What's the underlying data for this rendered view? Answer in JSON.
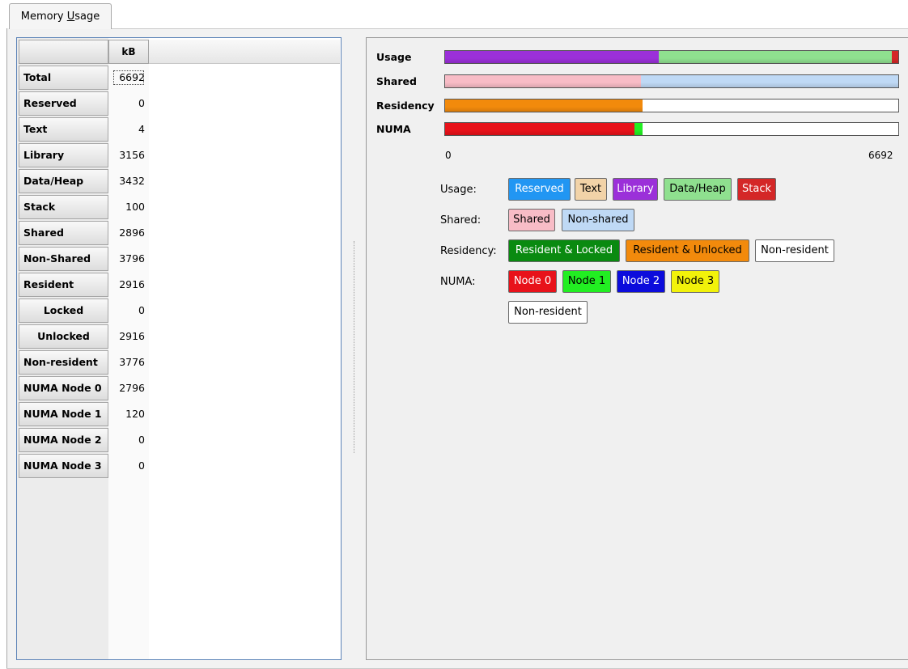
{
  "tab": {
    "label_pre": "Memory ",
    "label_mnemonic": "U",
    "label_post": "sage"
  },
  "table": {
    "column_header": "kB",
    "rows": [
      {
        "label": "Total",
        "value": "6692"
      },
      {
        "label": "Reserved",
        "value": "0"
      },
      {
        "label": "Text",
        "value": "4"
      },
      {
        "label": "Library",
        "value": "3156"
      },
      {
        "label": "Data/Heap",
        "value": "3432"
      },
      {
        "label": "Stack",
        "value": "100"
      },
      {
        "label": "Shared",
        "value": "2896"
      },
      {
        "label": "Non-Shared",
        "value": "3796"
      },
      {
        "label": "Resident",
        "value": "2916"
      },
      {
        "label": "Locked",
        "value": "0"
      },
      {
        "label": "Unlocked",
        "value": "2916"
      },
      {
        "label": "Non-resident",
        "value": "3776"
      },
      {
        "label": "NUMA Node 0",
        "value": "2796"
      },
      {
        "label": "NUMA Node 1",
        "value": "120"
      },
      {
        "label": "NUMA Node 2",
        "value": "0"
      },
      {
        "label": "NUMA Node 3",
        "value": "0"
      }
    ]
  },
  "bars": {
    "labels": {
      "usage": "Usage",
      "shared": "Shared",
      "residency": "Residency",
      "numa": "NUMA"
    },
    "axis_min": "0",
    "axis_max": "6692",
    "total": 6692,
    "usage": [
      {
        "name": "Reserved",
        "value": 0,
        "color": "#2196f3"
      },
      {
        "name": "Text",
        "value": 4,
        "color": "#f2d3a8"
      },
      {
        "name": "Library",
        "value": 3156,
        "color": "#9b30d9"
      },
      {
        "name": "Data/Heap",
        "value": 3432,
        "color": "#8fe08f"
      },
      {
        "name": "Stack",
        "value": 100,
        "color": "#d42727"
      }
    ],
    "shared": [
      {
        "name": "Shared",
        "value": 2896,
        "color": "#f8bcc6"
      },
      {
        "name": "Non-shared",
        "value": 3796,
        "color": "#bfd9f5"
      }
    ],
    "residency": [
      {
        "name": "Resident & Locked",
        "value": 0,
        "color": "#0a8a10"
      },
      {
        "name": "Resident & Unlocked",
        "value": 2916,
        "color": "#f28a0c"
      }
    ],
    "numa": [
      {
        "name": "Node 0",
        "value": 2796,
        "color": "#e8121a"
      },
      {
        "name": "Node 1",
        "value": 120,
        "color": "#22ee22"
      },
      {
        "name": "Node 2",
        "value": 0,
        "color": "#0c0cdc"
      },
      {
        "name": "Node 3",
        "value": 0,
        "color": "#f2f20a"
      }
    ]
  },
  "legend": {
    "usage_label": "Usage:",
    "shared_label": "Shared:",
    "residency_label": "Residency:",
    "numa_label": "NUMA:",
    "usage": [
      {
        "text": "Reserved",
        "bg": "#2196f3",
        "fg": "#ffffff"
      },
      {
        "text": "Text",
        "bg": "#f2d3a8",
        "fg": "#000000"
      },
      {
        "text": "Library",
        "bg": "#9b30d9",
        "fg": "#ffffff"
      },
      {
        "text": "Data/Heap",
        "bg": "#8fe08f",
        "fg": "#000000"
      },
      {
        "text": "Stack",
        "bg": "#d42727",
        "fg": "#ffffff"
      }
    ],
    "shared": [
      {
        "text": "Shared",
        "bg": "#f8bcc6",
        "fg": "#000000"
      },
      {
        "text": "Non-shared",
        "bg": "#bfd9f5",
        "fg": "#000000"
      }
    ],
    "residency": [
      {
        "text": "Resident & Locked",
        "bg": "#0a8a10",
        "fg": "#ffffff"
      },
      {
        "text": "Resident & Unlocked",
        "bg": "#f28a0c",
        "fg": "#000000"
      },
      {
        "text": "Non-resident",
        "bg": "#ffffff",
        "fg": "#000000"
      }
    ],
    "numa": [
      {
        "text": "Node 0",
        "bg": "#e8121a",
        "fg": "#ffffff"
      },
      {
        "text": "Node 1",
        "bg": "#22ee22",
        "fg": "#000000"
      },
      {
        "text": "Node 2",
        "bg": "#0c0cdc",
        "fg": "#ffffff"
      },
      {
        "text": "Node 3",
        "bg": "#f2f20a",
        "fg": "#000000"
      },
      {
        "text": "Non-resident",
        "bg": "#ffffff",
        "fg": "#000000"
      }
    ]
  }
}
